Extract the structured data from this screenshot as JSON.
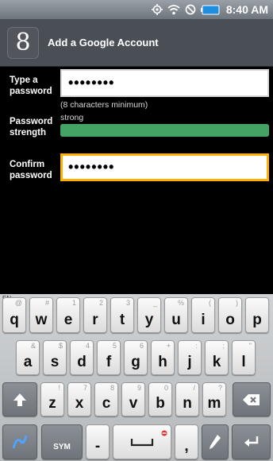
{
  "status_bar": {
    "time": "8:40 AM",
    "icons": [
      "gps-icon",
      "wifi-icon",
      "no-signal-icon",
      "battery-icon"
    ]
  },
  "header": {
    "app_icon_glyph": "8",
    "title": "Add a Google Account"
  },
  "form": {
    "password_label": "Type a password",
    "password_value": "••••••••",
    "hint": "(8 characters minimum)",
    "strength_label": "Password strength",
    "strength_value": "strong",
    "strength_color": "#43a466",
    "confirm_label": "Confirm password",
    "confirm_value": "••••••••",
    "focused_border_color": "#ffb000"
  },
  "keyboard": {
    "lang": "EN",
    "row1": [
      {
        "key": "q",
        "alt": "@"
      },
      {
        "key": "w",
        "alt": "#"
      },
      {
        "key": "e",
        "alt": "1"
      },
      {
        "key": "r",
        "alt": "2"
      },
      {
        "key": "t",
        "alt": "3"
      },
      {
        "key": "y",
        "alt": "_"
      },
      {
        "key": "u",
        "alt": "%"
      },
      {
        "key": "i",
        "alt": "("
      },
      {
        "key": "o",
        "alt": ")"
      },
      {
        "key": "p",
        "alt": ""
      }
    ],
    "row2": [
      {
        "key": "a",
        "alt": "&"
      },
      {
        "key": "s",
        "alt": "$"
      },
      {
        "key": "d",
        "alt": "4"
      },
      {
        "key": "f",
        "alt": "5"
      },
      {
        "key": "g",
        "alt": "6"
      },
      {
        "key": "h",
        "alt": "+"
      },
      {
        "key": "j",
        "alt": ":"
      },
      {
        "key": "k",
        "alt": ";"
      },
      {
        "key": "l",
        "alt": "\""
      }
    ],
    "row3": [
      {
        "key": "z",
        "alt": "!"
      },
      {
        "key": "x",
        "alt": "7"
      },
      {
        "key": "c",
        "alt": "8"
      },
      {
        "key": "v",
        "alt": "9"
      },
      {
        "key": "b",
        "alt": "0"
      },
      {
        "key": "n",
        "alt": "/"
      },
      {
        "key": "m",
        "alt": "?"
      }
    ],
    "sym_label": "SYM",
    "dash_key": "-",
    "comma_key": ","
  }
}
